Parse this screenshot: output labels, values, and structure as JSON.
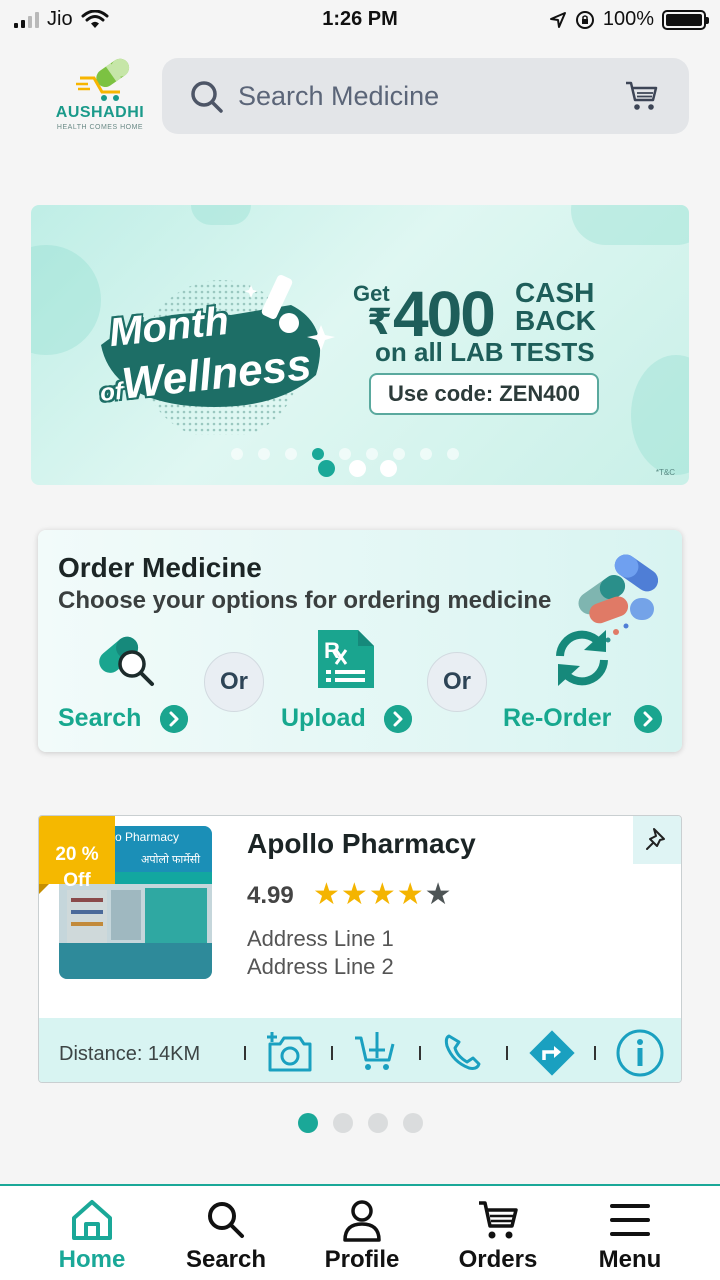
{
  "status_bar": {
    "carrier": "Jio",
    "time": "1:26 PM",
    "battery": "100%"
  },
  "header": {
    "logo_text": "AUSHADHI",
    "logo_tagline": "HEALTH COMES HOME",
    "search_placeholder": "Search Medicine"
  },
  "banner": {
    "title_line1": "Month",
    "title_of": "of",
    "title_line2": "Wellness",
    "offer_get": "Get",
    "offer_rupee": "₹",
    "offer_amount": "400",
    "offer_cash": "CASH",
    "offer_back": "BACK",
    "offer_lab": "on all LAB TESTS",
    "offer_code": "Use code: ZEN400",
    "tnc": "*T&C",
    "active_slide": 1,
    "total_slides": 3
  },
  "order": {
    "title": "Order Medicine",
    "subtitle": "Choose your options for ordering medicine",
    "options": [
      {
        "label": "Search",
        "icon": "pill-search-icon"
      },
      {
        "label": "Upload",
        "icon": "prescription-icon"
      },
      {
        "label": "Re-Order",
        "icon": "reorder-icon"
      }
    ],
    "or_label": "Or"
  },
  "pharmacy": {
    "discount_line1": "20 %",
    "discount_line2": "Off",
    "sign_en": "o Pharmacy",
    "sign_hi": "अपोलो फार्मेसी",
    "name": "Apollo Pharmacy",
    "rating": "4.99",
    "stars_filled": 4,
    "stars_total": 5,
    "address_line1": "Address Line 1",
    "address_line2": "Address Line 2",
    "distance": "Distance: 14KM",
    "actions": [
      "camera-icon",
      "add-to-cart-icon",
      "phone-icon",
      "directions-icon",
      "info-icon"
    ]
  },
  "pager": {
    "active": 0,
    "total": 4
  },
  "nav": {
    "items": [
      {
        "label": "Home",
        "icon": "home-icon",
        "active": true
      },
      {
        "label": "Search",
        "icon": "search-icon",
        "active": false
      },
      {
        "label": "Profile",
        "icon": "profile-icon",
        "active": false
      },
      {
        "label": "Orders",
        "icon": "cart-icon",
        "active": false
      },
      {
        "label": "Menu",
        "icon": "menu-icon",
        "active": false
      }
    ]
  },
  "colors": {
    "accent": "#1aa898",
    "discount": "#f5b800",
    "star": "#f4b400"
  }
}
